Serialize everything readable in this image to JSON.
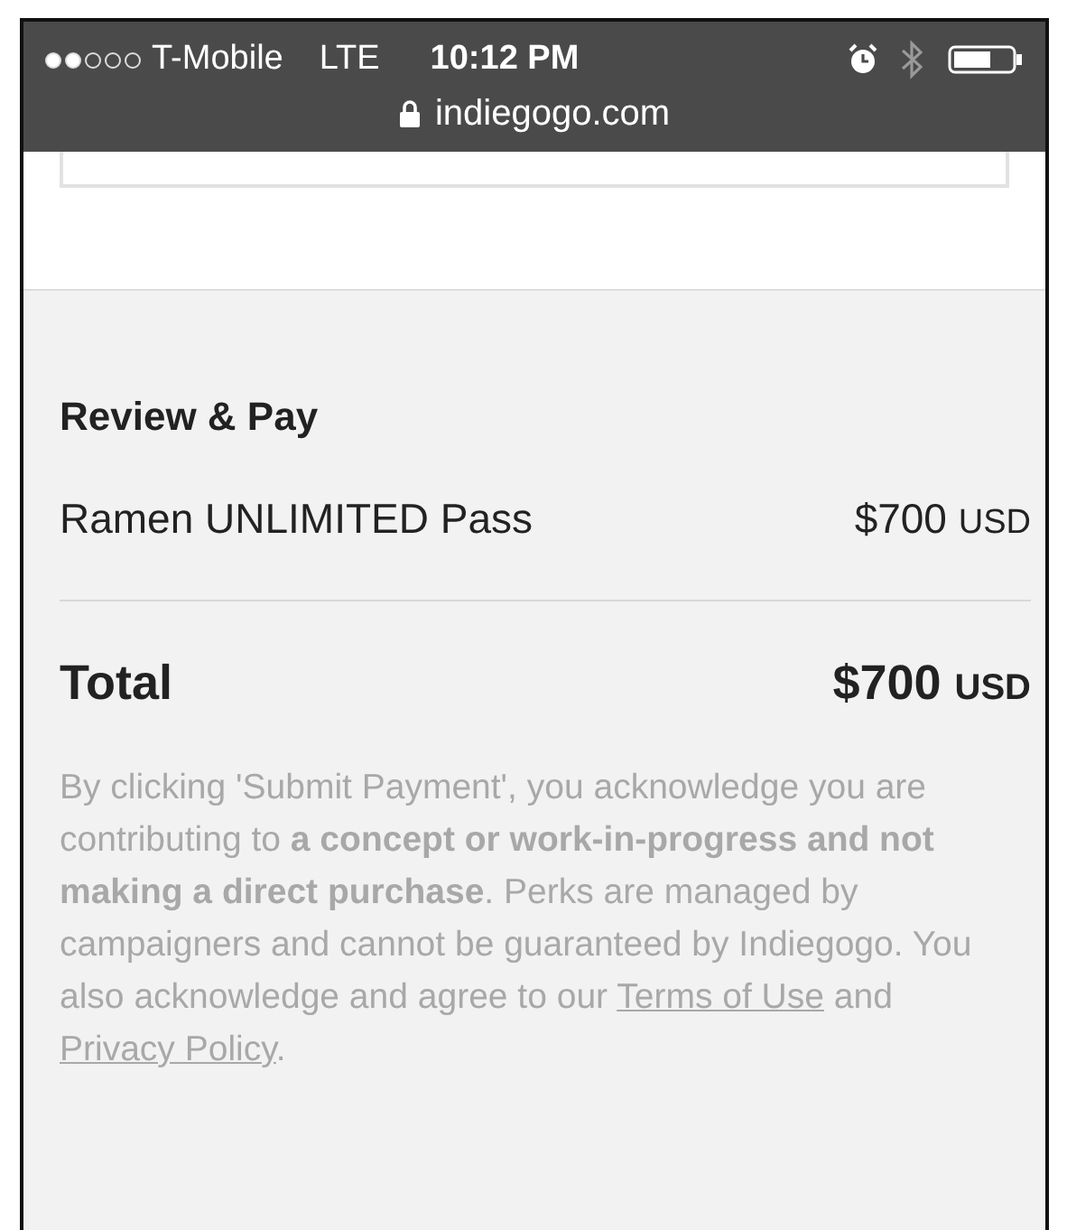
{
  "status_bar": {
    "carrier": "T-Mobile",
    "network": "LTE",
    "time": "10:12 PM",
    "url": "indiegogo.com"
  },
  "review": {
    "title": "Review & Pay",
    "items": [
      {
        "name": "Ramen UNLIMITED Pass",
        "amount": "$700",
        "currency": "USD"
      }
    ],
    "total": {
      "label": "Total",
      "amount": "$700",
      "currency": "USD"
    }
  },
  "disclaimer": {
    "text": "By clicking 'Submit Payment', you acknowledge you are contributing to **a concept or work-in-progress and not making a direct purchase**. Perks are managed by campaigners and cannot be guaranteed by Indiegogo. You also acknowledge and agree to our",
    "links": [
      {
        "label": "Terms of Use"
      },
      {
        "label": "Privacy Policy"
      }
    ],
    "connector": "and",
    "end": "."
  }
}
